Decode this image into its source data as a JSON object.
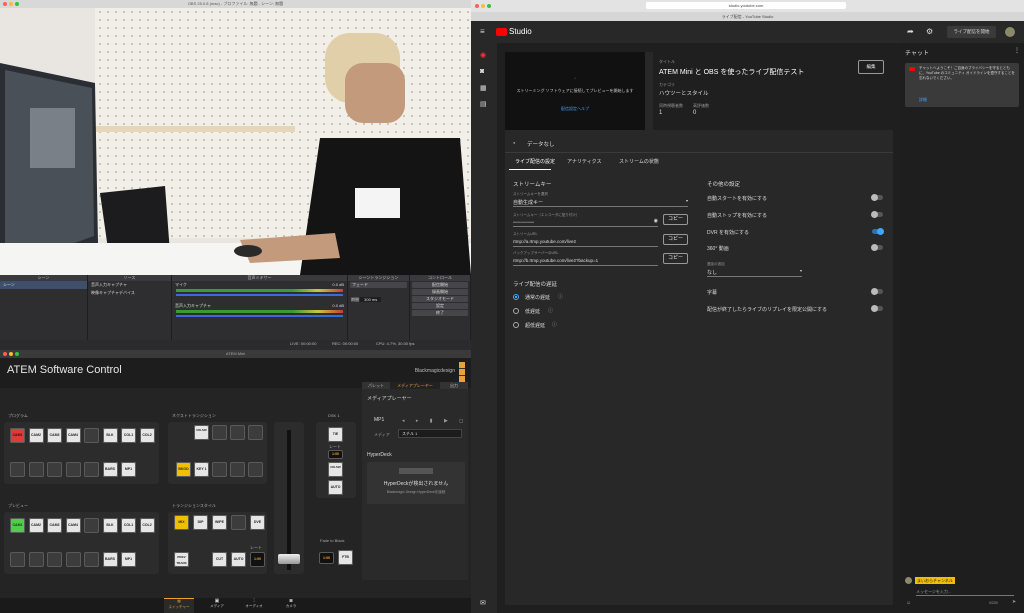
{
  "obs": {
    "window_title": "OBS 25.0.8 (mac) - プロファイル: 無題 - シーン: 無題",
    "docks": {
      "scenes": {
        "header": "シーン",
        "item": "シーン"
      },
      "sources": {
        "header": "ソース",
        "items": [
          "音声入力キャプチャ",
          "映像キャプチャデバイス"
        ]
      },
      "mixer": {
        "header": "音声ミキサー",
        "ch1": "マイク",
        "ch1_db": "0.0 dB",
        "ch2": "音声入力キャプチャ",
        "ch2_db": "0.0 dB"
      },
      "transitions": {
        "header": "シーントランジション",
        "type": "フェード",
        "duration_label": "期間",
        "duration": "300 ms"
      },
      "controls": {
        "header": "コントロール",
        "buttons": [
          "配信開始",
          "録画開始",
          "スタジオモード",
          "設定",
          "終了"
        ]
      }
    },
    "status": {
      "live": "LIVE: 00:00:00",
      "rec": "REC: 00:00:00",
      "cpu": "CPU: 4.7%, 30.00 fps"
    }
  },
  "atem": {
    "window_title": "ATEM Mini",
    "app_title": "ATEM Software Control",
    "brand": "Blackmagicdesign",
    "program_label": "プログラム",
    "preview_label": "プレビュー",
    "next_transition_label": "ネクストトランジション",
    "transition_style_label": "トランジションスタイル",
    "dsk_label": "DSK 1",
    "program_buttons": [
      "CAM1",
      "CAM2",
      "CAM3",
      "CAM4",
      "",
      "BLK",
      "COL1",
      "COL2"
    ],
    "program_row2": [
      "",
      "",
      "",
      "",
      "",
      "BARS",
      "MP1"
    ],
    "preview_buttons": [
      "CAM1",
      "CAM2",
      "CAM3",
      "CAM4",
      "",
      "BLK",
      "COL1",
      "COL2"
    ],
    "preview_row2": [
      "",
      "",
      "",
      "",
      "",
      "BARS",
      "MP1"
    ],
    "next_transition": {
      "on_air": "ON AIR",
      "bkgd": "BKGD",
      "key1": "KEY 1"
    },
    "styles": {
      "mix": "MIX",
      "dip": "DIP",
      "wipe": "WIPE",
      "dve": "DVE",
      "prev_trans": "PREV TRANS",
      "cut": "CUT",
      "auto": "AUTO",
      "rate_label": "レート",
      "rate": "1:00"
    },
    "dsk": {
      "tie": "TIE",
      "rate_label": "レート",
      "rate": "1:00",
      "on_air": "ON AIR",
      "auto": "AUTO"
    },
    "ftb": {
      "label": "Fade to Black",
      "rate": "1:00",
      "button": "FTB"
    },
    "side_tabs": [
      "パレット",
      "メディアプレーヤー",
      "出力"
    ],
    "media_player": {
      "title": "メディアプレーヤー",
      "mp": "MP1",
      "media_label": "メディア",
      "media_value": "スチル 1"
    },
    "hyperdeck": {
      "title": "HyperDeck",
      "message": "HyperDeckが検出されません",
      "sub": "Blackmagic Design HyperDeckを接続"
    },
    "bottom_nav": [
      "スイッチャー",
      "メディア",
      "オーディオ",
      "カメラ"
    ]
  },
  "browser": {
    "url": "studio.youtube.com",
    "tab_title": "ライブ配信 - YouTube Studio"
  },
  "yt": {
    "logo": "Studio",
    "go_live": "ライブ配信を開始",
    "preview_msg": "ストリーミング ソフトウェアに接続してプレビューを開始します",
    "help_link": "配信設定ヘルプ",
    "title_label": "タイトル",
    "title": "ATEM Mini と OBS を使ったライブ配信テスト",
    "category_label": "カテゴリ",
    "category": "ハウツーとスタイル",
    "viewers_label": "同時視聴者数",
    "viewers": "1",
    "likes_label": "高評価数",
    "likes": "0",
    "edit": "編集",
    "status": "データなし",
    "tabs": [
      "ライブ配信の設定",
      "アナリティクス",
      "ストリームの状態"
    ],
    "stream_key_section": "ストリームキー",
    "key_select_label": "ストリームキーを選択",
    "key_select": "自動生成キー",
    "key_field_label": "ストリームキー（エンコーダに貼り付け）",
    "key_value": "••••••••••••••••••••",
    "copy": "コピー",
    "url_label": "ストリームURL",
    "url": "rtmp://a.rtmp.youtube.com/live2",
    "backup_label": "バックアップサーバーのURL",
    "backup": "rtmp://b.rtmp.youtube.com/live2?backup=1",
    "latency_section": "ライブ配信の遅延",
    "latency": [
      "通常の遅延",
      "低遅延",
      "超低遅延"
    ],
    "other_section": "その他の設定",
    "settings": [
      {
        "label": "自動スタートを有効にする",
        "on": false
      },
      {
        "label": "自動ストップを有効にする",
        "on": false
      },
      {
        "label": "DVR を有効にする",
        "on": true
      },
      {
        "label": "360° 動画",
        "on": false
      }
    ],
    "delay_label": "遅延の追加",
    "delay": "なし",
    "captions": "字幕",
    "replay": "配信が終了したらライブのリプレイを限定公開にする",
    "chat": {
      "title": "チャット",
      "notice": "チャットへようこそ！ご自身のプライバシーを守るとともに、YouTube のコミュニティ ガイドラインを遵守することを忘れないでください。",
      "more": "詳細",
      "user": "まいおらチャンネル",
      "placeholder": "メッセージを入力...",
      "count": "0/200"
    }
  }
}
